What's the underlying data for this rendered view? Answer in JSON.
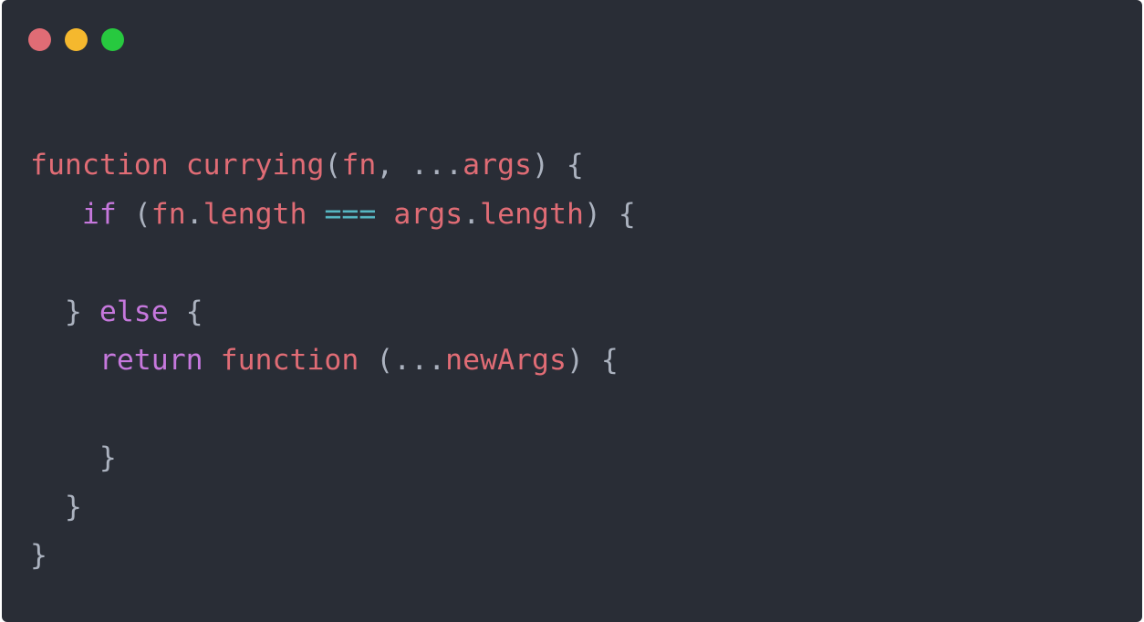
{
  "window": {
    "controls": {
      "close_color": "#e06c75",
      "minimize_color": "#f5b82e",
      "maximize_color": "#27c93f"
    }
  },
  "code": {
    "lines": [
      [
        {
          "t": "function",
          "c": "kw-fn"
        },
        {
          "t": " ",
          "c": "punct"
        },
        {
          "t": "currying",
          "c": "ident"
        },
        {
          "t": "(",
          "c": "punct"
        },
        {
          "t": "fn",
          "c": "ident"
        },
        {
          "t": ", ...",
          "c": "punct"
        },
        {
          "t": "args",
          "c": "ident"
        },
        {
          "t": ") {",
          "c": "punct"
        }
      ],
      [
        {
          "t": "   ",
          "c": "punct"
        },
        {
          "t": "if",
          "c": "kw-ctrl"
        },
        {
          "t": " (",
          "c": "punct"
        },
        {
          "t": "fn",
          "c": "ident"
        },
        {
          "t": ".",
          "c": "punct"
        },
        {
          "t": "length",
          "c": "ident"
        },
        {
          "t": " ",
          "c": "punct"
        },
        {
          "t": "===",
          "c": "op"
        },
        {
          "t": " ",
          "c": "punct"
        },
        {
          "t": "args",
          "c": "ident"
        },
        {
          "t": ".",
          "c": "punct"
        },
        {
          "t": "length",
          "c": "ident"
        },
        {
          "t": ") {",
          "c": "punct"
        }
      ],
      [],
      [
        {
          "t": "  } ",
          "c": "punct"
        },
        {
          "t": "else",
          "c": "kw-ctrl"
        },
        {
          "t": " {",
          "c": "punct"
        }
      ],
      [
        {
          "t": "    ",
          "c": "punct"
        },
        {
          "t": "return",
          "c": "kw-ctrl"
        },
        {
          "t": " ",
          "c": "punct"
        },
        {
          "t": "function",
          "c": "kw-fn"
        },
        {
          "t": " (...",
          "c": "punct"
        },
        {
          "t": "newArgs",
          "c": "ident"
        },
        {
          "t": ") {",
          "c": "punct"
        }
      ],
      [],
      [
        {
          "t": "    }",
          "c": "punct"
        }
      ],
      [
        {
          "t": "  }",
          "c": "punct"
        }
      ],
      [
        {
          "t": "}",
          "c": "punct"
        }
      ]
    ]
  }
}
